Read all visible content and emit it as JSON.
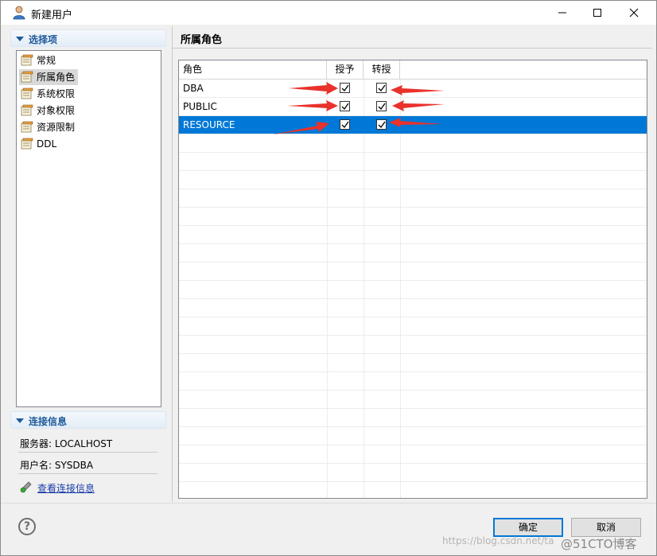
{
  "window": {
    "title": "新建用户"
  },
  "left": {
    "options_header": "选择项",
    "nav_items": [
      {
        "label": "常规",
        "selected": false
      },
      {
        "label": "所属角色",
        "selected": true
      },
      {
        "label": "系统权限",
        "selected": false
      },
      {
        "label": "对象权限",
        "selected": false
      },
      {
        "label": "资源限制",
        "selected": false
      },
      {
        "label": "DDL",
        "selected": false
      }
    ],
    "connection_header": "连接信息",
    "server_line": "服务器: LOCALHOST",
    "user_line": "用户名: SYSDBA",
    "view_link": "查看连接信息"
  },
  "right": {
    "page_title": "所属角色",
    "columns": {
      "role": "角色",
      "grant": "授予",
      "admin": "转授"
    },
    "rows": [
      {
        "role": "DBA",
        "grant": true,
        "admin": true,
        "selected": false
      },
      {
        "role": "PUBLIC",
        "grant": true,
        "admin": true,
        "selected": false
      },
      {
        "role": "RESOURCE",
        "grant": true,
        "admin": true,
        "selected": true
      }
    ]
  },
  "buttons": {
    "ok": "确定",
    "cancel": "取消"
  },
  "watermark": "https://blog.csdn.net/ta",
  "watermark_brand": "@51CTO博客",
  "colors": {
    "selection": "#0078d7",
    "annotation_arrow": "#e8322b",
    "section_header_text": "#1e5a9b"
  }
}
